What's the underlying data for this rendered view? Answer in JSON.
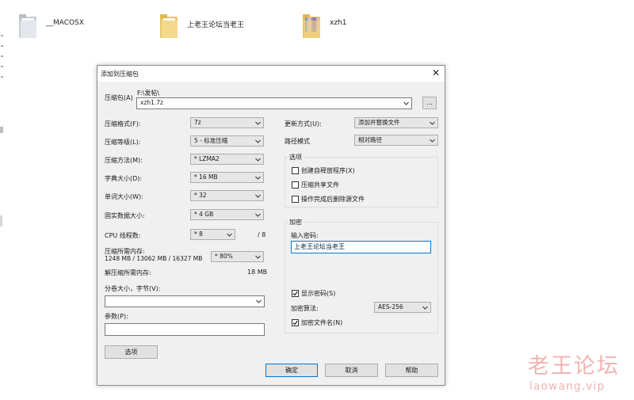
{
  "desktop": {
    "files": [
      {
        "name": "__MACOSX",
        "icon": "folder-icon"
      },
      {
        "name": "上老王论坛当老王",
        "icon": "folder-icon"
      },
      {
        "name": "xzh1",
        "icon": "folder-thumbnail-icon"
      }
    ]
  },
  "dialog": {
    "title": "添加到压缩包",
    "close_glyph": "✕",
    "archive": {
      "label": "压缩包(A)",
      "path": "F:\\发帖\\",
      "filename": "xzh1.7z",
      "browse_label": "..."
    },
    "left": {
      "format_label": "压缩格式(F):",
      "format_value": "7z",
      "level_label": "压缩等级(L):",
      "level_value": "5 - 标准压缩",
      "method_label": "压缩方法(M):",
      "method_value": "* LZMA2",
      "dict_label": "字典大小(D):",
      "dict_value": "* 16 MB",
      "word_label": "单词大小(W):",
      "word_value": "* 32",
      "solid_label": "固实数据大小:",
      "solid_value": "* 4 GB",
      "cpu_label": "CPU 线程数:",
      "cpu_value": "* 8",
      "cpu_max": "/ 8",
      "mem_comp_label": "压缩所需内存:",
      "mem_comp_value": "1248 MB / 13062 MB / 16327 MB",
      "mem_comp_pct": "* 80%",
      "mem_decomp_label": "解压缩所需内存:",
      "mem_decomp_value": "18 MB",
      "split_label": "分卷大小，字节(V):",
      "split_value": "",
      "params_label": "参数(P):",
      "params_value": "",
      "options_button": "选项"
    },
    "right": {
      "update_label": "更新方式(U):",
      "update_value": "添加并替换文件",
      "path_label": "路径模式",
      "path_value": "相对路径",
      "options_group": "选项",
      "opt_sfx": "创建自释放程序(X)",
      "opt_shared": "压缩共享文件",
      "opt_delete": "操作完成后删除源文件",
      "encryption_group": "加密",
      "password_label": "输入密码:",
      "password_value": "上老王论坛当老王",
      "show_password": "显示密码(S)",
      "enc_method_label": "加密算法:",
      "enc_method_value": "AES-256",
      "encrypt_names": "加密文件名(N)"
    },
    "buttons": {
      "ok": "确定",
      "cancel": "取消",
      "help": "帮助"
    }
  },
  "watermark": {
    "title": "老王论坛",
    "url": "laowang.vip"
  }
}
